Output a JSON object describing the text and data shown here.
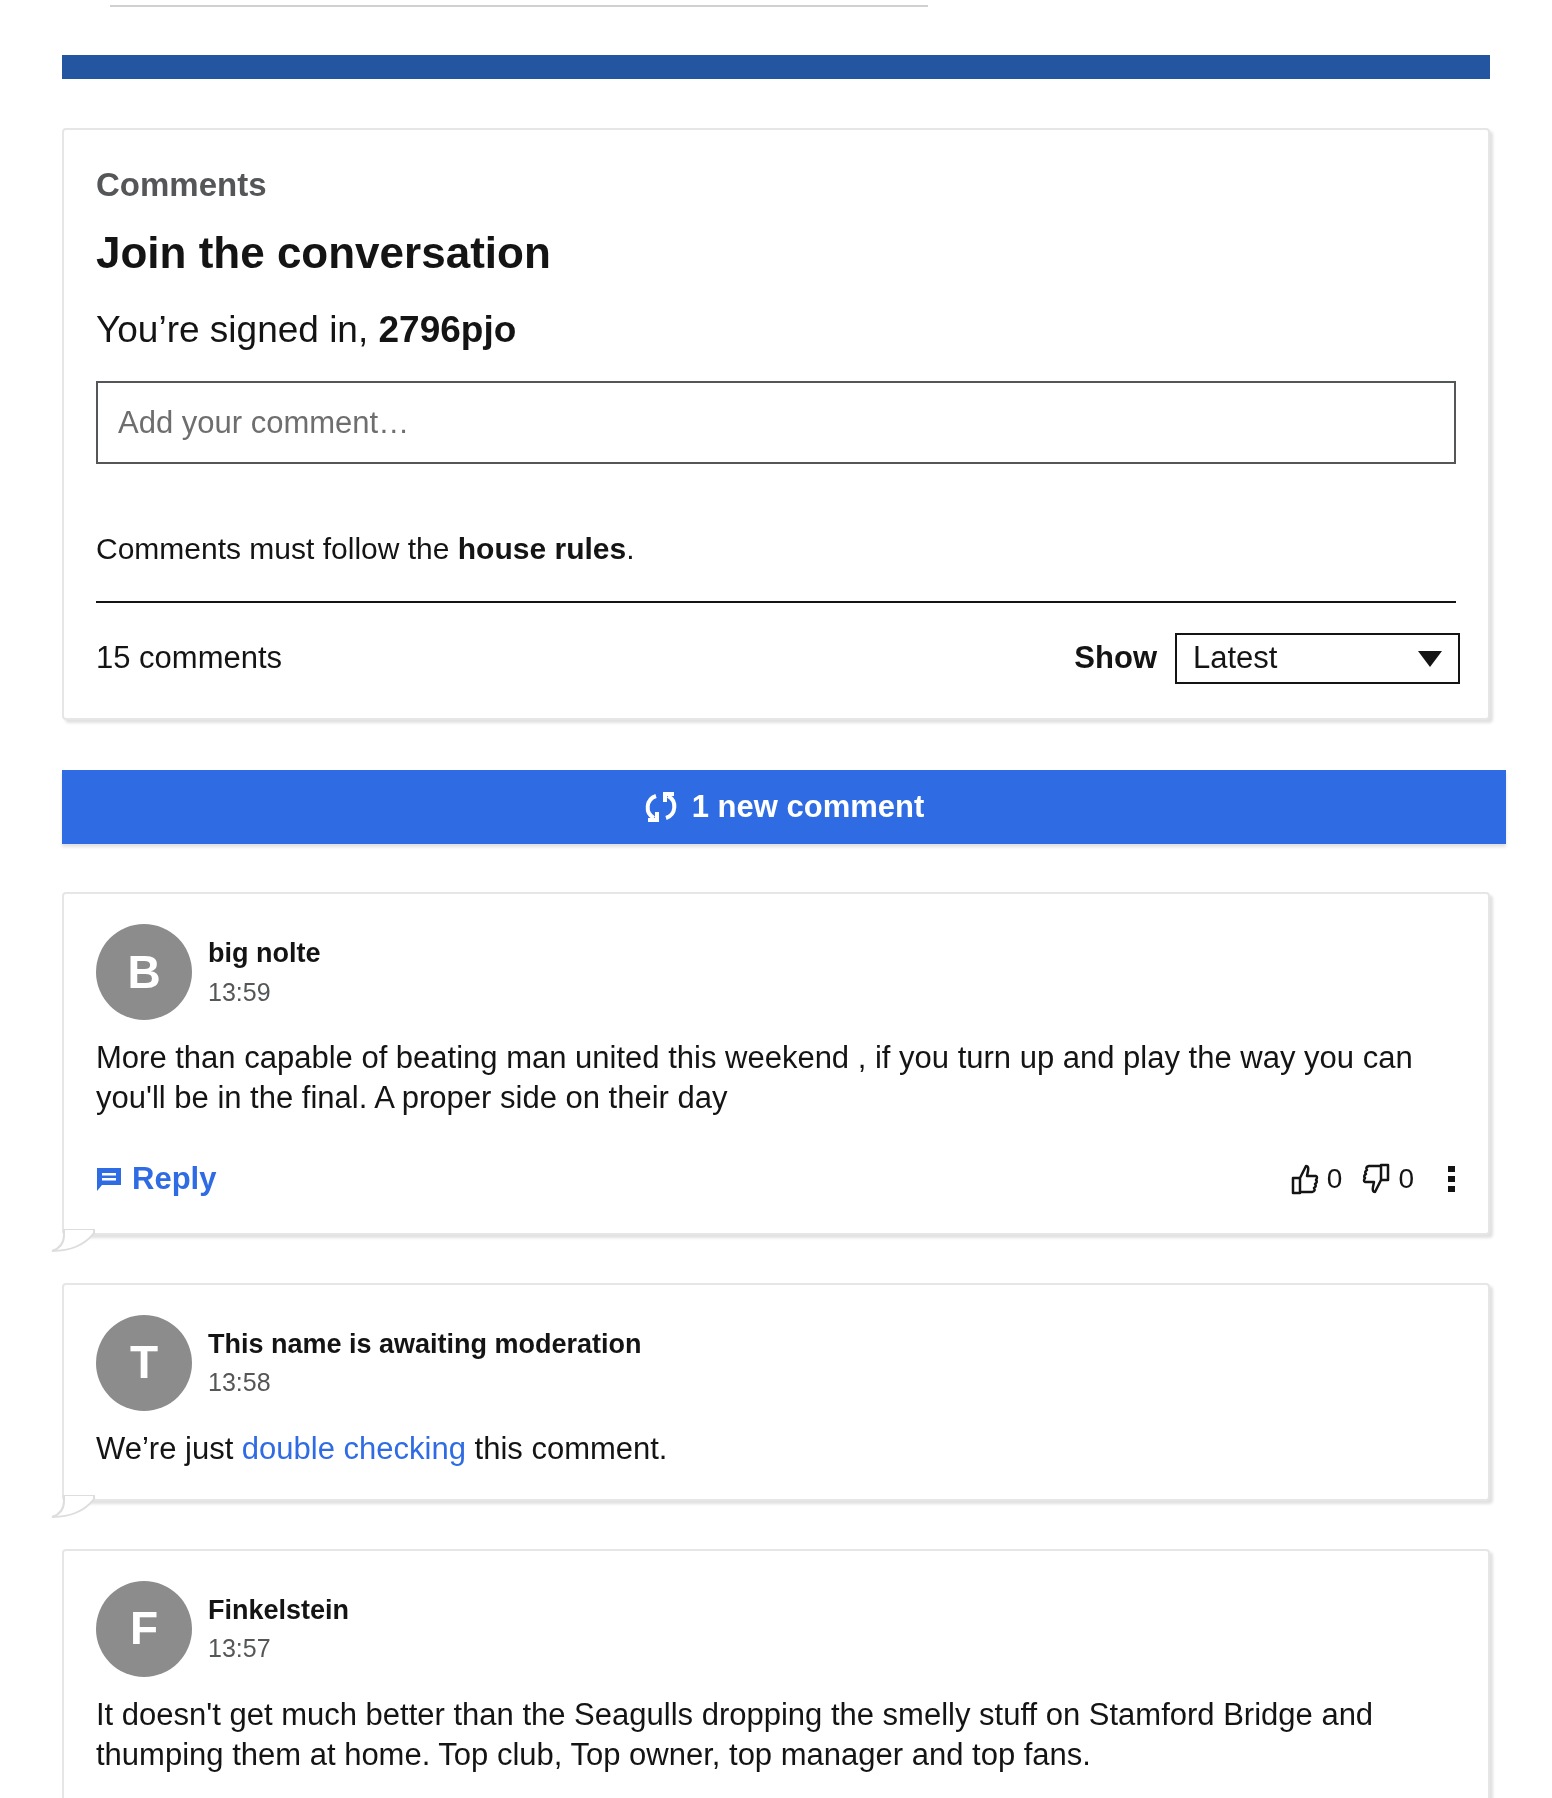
{
  "comments_panel": {
    "heading": "Comments",
    "title": "Join the conversation",
    "signed_in": "You’re signed in, **2796pjo**",
    "comment_field": {
      "placeholder": "Add your comment…"
    },
    "rules_notice": {
      "before": "Comments must follow the ",
      "link": "house rules",
      "after": "."
    },
    "count": "15 comments",
    "sort": {
      "label": "Show",
      "value": "Latest"
    }
  },
  "new_comments_button": "1 new comment",
  "comments": [
    {
      "kind": "comment",
      "initial": "B",
      "author": "big nolte",
      "time": "13:59",
      "text": "More than capable of beating man united this weekend , if you turn up and play the way you can you'll be in the final. A proper side on their day",
      "reply": "Reply",
      "likes": "0",
      "dislikes": "0"
    },
    {
      "kind": "moderation",
      "initial": "T",
      "author": "This name is awaiting moderation",
      "time": "13:58",
      "before": "We’re just ",
      "link": "double checking",
      "after": " this comment."
    },
    {
      "kind": "comment",
      "initial": "F",
      "author": "Finkelstein",
      "time": "13:57",
      "text": "It doesn't get much better than the Seagulls dropping the smelly stuff on Stamford Bridge and thumping them at home. Top club, Top owner, top manager and top fans."
    }
  ]
}
